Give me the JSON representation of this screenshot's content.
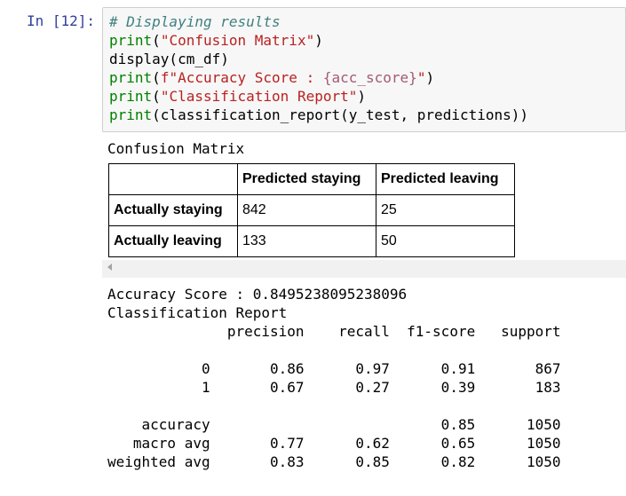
{
  "prompt": "In [12]:",
  "code": {
    "comment": "# Displaying results",
    "l2_fn": "print",
    "l2_str": "\"Confusion Matrix\"",
    "l3": "display(cm_df)",
    "l4_fn": "print",
    "l4_str_a": "f\"Accuracy Score : ",
    "l4_interp": "{acc_score}",
    "l4_str_b": "\"",
    "l5_fn": "print",
    "l5_str": "\"Classification Report\"",
    "l6_fn": "print",
    "l6_rest": "(classification_report(y_test, predictions))"
  },
  "output": {
    "cm_title": "Confusion Matrix",
    "table": {
      "headers": [
        "",
        "Predicted staying",
        "Predicted leaving"
      ],
      "rows": [
        {
          "label": "Actually staying",
          "values": [
            "842",
            "25"
          ]
        },
        {
          "label": "Actually leaving",
          "values": [
            "133",
            "50"
          ]
        }
      ]
    },
    "accuracy_line": "Accuracy Score : 0.8495238095238096",
    "report_title": "Classification Report",
    "report_text": "              precision    recall  f1-score   support\n\n           0       0.86      0.97      0.91       867\n           1       0.67      0.27      0.39       183\n\n    accuracy                           0.85      1050\n   macro avg       0.77      0.62      0.65      1050\nweighted avg       0.83      0.85      0.82      1050"
  }
}
